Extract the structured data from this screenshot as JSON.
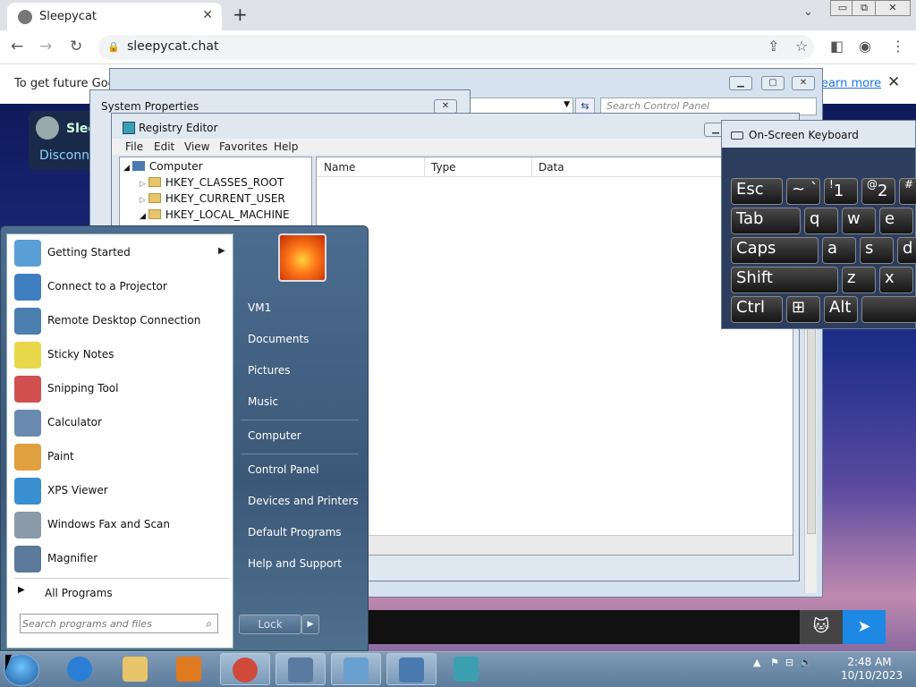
{
  "browser": {
    "tab_title": "Sleepycat",
    "tab_close": "✕",
    "new_tab": "+",
    "tab_menu": "⌄",
    "url": "sleepycat.chat",
    "info_text": "To get future Goo",
    "info_link": "earn more",
    "info_close": "✕"
  },
  "sleepycat": {
    "name": "Slee",
    "disconnect": "Disconn"
  },
  "control_panel": {
    "search_placeholder": "Search Control Panel",
    "refresh": "⇆"
  },
  "system_properties": {
    "title": "System Properties"
  },
  "registry": {
    "title": "Registry Editor",
    "menu": [
      "File",
      "Edit",
      "View",
      "Favorites",
      "Help"
    ],
    "tree": [
      {
        "label": "Computer"
      },
      {
        "label": "HKEY_CLASSES_ROOT"
      },
      {
        "label": "HKEY_CURRENT_USER"
      },
      {
        "label": "HKEY_LOCAL_MACHINE"
      }
    ],
    "columns": [
      "Name",
      "Type",
      "Data"
    ]
  },
  "osk": {
    "title": "On-Screen Keyboard",
    "rows": [
      [
        {
          "label": "Esc"
        },
        {
          "label": "~ `"
        },
        {
          "label": "1",
          "sup": "!"
        },
        {
          "label": "2",
          "sup": "@"
        },
        {
          "label": "",
          "sup": "#"
        }
      ],
      [
        {
          "label": "Tab"
        },
        {
          "label": "q"
        },
        {
          "label": "w"
        },
        {
          "label": "e"
        }
      ],
      [
        {
          "label": "Caps"
        },
        {
          "label": "a"
        },
        {
          "label": "s"
        },
        {
          "label": "d"
        }
      ],
      [
        {
          "label": "Shift"
        },
        {
          "label": "z"
        },
        {
          "label": "x"
        }
      ],
      [
        {
          "label": "Ctrl"
        },
        {
          "label": "⊞"
        },
        {
          "label": "Alt"
        },
        {
          "label": ""
        }
      ]
    ]
  },
  "start_menu": {
    "programs": [
      {
        "label": "Getting Started",
        "has_arrow": true,
        "color": "#5a9fd6"
      },
      {
        "label": "Connect to a Projector",
        "color": "#3f7fbf"
      },
      {
        "label": "Remote Desktop Connection",
        "color": "#4a7fb0"
      },
      {
        "label": "Sticky Notes",
        "color": "#e8d84a"
      },
      {
        "label": "Snipping Tool",
        "color": "#d05050"
      },
      {
        "label": "Calculator",
        "color": "#6a8ab0"
      },
      {
        "label": "Paint",
        "color": "#e0a040"
      },
      {
        "label": "XPS Viewer",
        "color": "#3a8fd0"
      },
      {
        "label": "Windows Fax and Scan",
        "color": "#8a9aa8"
      },
      {
        "label": "Magnifier",
        "color": "#5a7a9a"
      }
    ],
    "all_programs": "All Programs",
    "search_placeholder": "Search programs and files",
    "right_items": [
      "VM1",
      "Documents",
      "Pictures",
      "Music",
      "Computer",
      "Control Panel",
      "Devices and Printers",
      "Default Programs",
      "Help and Support"
    ],
    "lock": "Lock"
  },
  "taskbar": {
    "time": "2:48 AM",
    "date": "10/10/2023",
    "apps": [
      {
        "name": "ie",
        "color": "#2a7fd4"
      },
      {
        "name": "explorer",
        "color": "#e8c46a"
      },
      {
        "name": "media",
        "color": "#e07a20"
      },
      {
        "name": "chrome",
        "color": "#d04a3a"
      },
      {
        "name": "osk",
        "color": "#5a7aa0"
      },
      {
        "name": "control-panel",
        "color": "#6aa0d0"
      },
      {
        "name": "system",
        "color": "#4a7ab0"
      },
      {
        "name": "regedit",
        "color": "#3aa0b0"
      }
    ]
  },
  "colors": {
    "chrome_blue": "#1a73e8",
    "send_blue": "#1e88e5"
  }
}
